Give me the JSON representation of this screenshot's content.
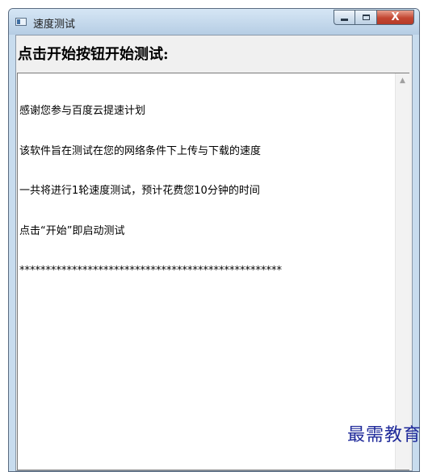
{
  "window": {
    "title": "速度测试",
    "close_glyph": "X"
  },
  "heading": "点击开始按钮开始测试:",
  "log": {
    "lines": [
      "感谢您参与百度云提速计划",
      "该软件旨在测试在您的网络条件下上传与下载的速度",
      "一共将进行1轮速度测试，预计花费您10分钟的时间",
      "点击“开始”即启动测试",
      "**************************************************"
    ]
  },
  "watermark": "最需教育",
  "icons": {
    "app": "app-icon",
    "minimize": "minimize-icon",
    "maximize": "maximize-icon",
    "close": "close-icon",
    "scroll_up": "scroll-up-arrow-icon"
  },
  "colors": {
    "close_button": "#c34632",
    "titlebar": "#c8dcee",
    "watermark": "#1f2a9a"
  }
}
